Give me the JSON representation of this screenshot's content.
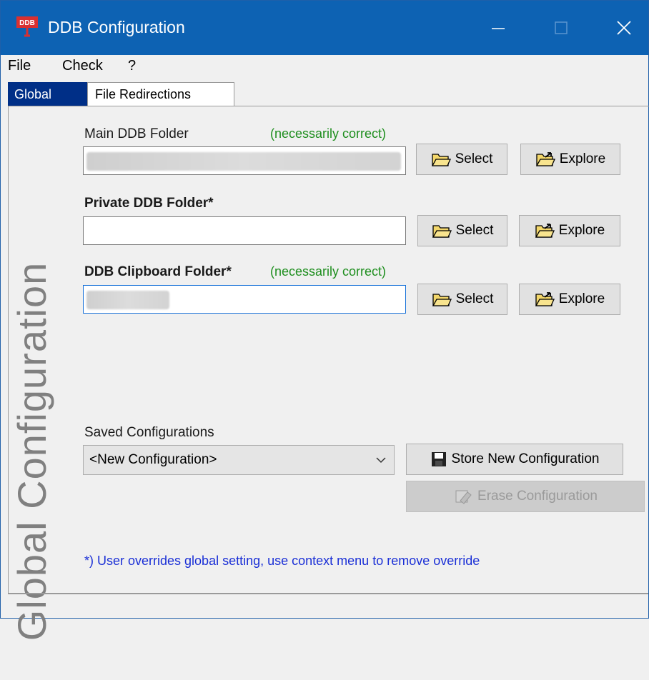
{
  "window": {
    "title": "DDB Configuration",
    "app_icon_label": "DDB"
  },
  "menu": {
    "items": [
      "File",
      "Check",
      "?"
    ]
  },
  "tabs": [
    {
      "label": "Global"
    },
    {
      "label": "File Redirections"
    }
  ],
  "panel": {
    "vertical_title": "Global Configuration",
    "main_folder": {
      "label": "Main DDB Folder",
      "note": "(necessarily correct)",
      "value": ""
    },
    "private_folder": {
      "label": "Private DDB Folder*",
      "value": ""
    },
    "clipboard_folder": {
      "label": "DDB Clipboard Folder*",
      "note": "(necessarily correct)",
      "value": ""
    },
    "buttons": {
      "select": "Select",
      "explore": "Explore"
    },
    "saved": {
      "label": "Saved Configurations",
      "selected": "<New Configuration>",
      "store_button": "Store New Configuration",
      "erase_button": "Erase Configuration"
    },
    "footnote": "*) User overrides global setting, use context menu to remove override"
  },
  "colors": {
    "titlebar": "#0d62b3",
    "green_note": "#1e8e1e",
    "footnote": "#1a2fd6",
    "active_tab": "#002f87"
  }
}
